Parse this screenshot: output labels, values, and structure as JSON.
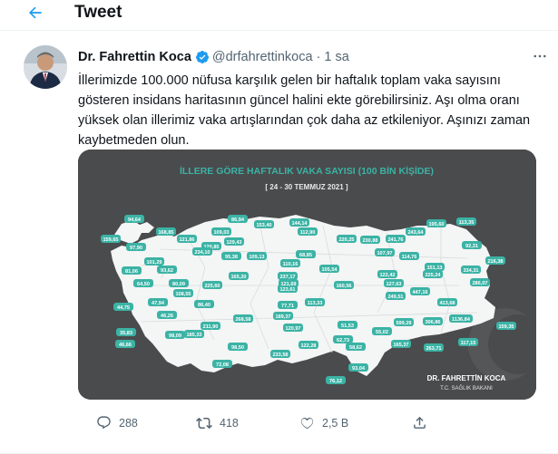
{
  "header": {
    "title": "Tweet"
  },
  "tweet": {
    "author_name": "Dr. Fahrettin Koca",
    "handle": "@drfahrettinkoca",
    "separator": "·",
    "time": "1 sa",
    "text_lines": [
      "İllerimizde 100.000 nüfusa karşılık gelen bir haftalık toplam vaka sayısını",
      "gösteren insidans haritasının güncel halini ekte görebilirsiniz. Aşı olma oranı",
      "yüksek olan illerimiz vaka artışlarından çok daha az etkileniyor. Aşınızı zaman",
      "kaybetmeden olun."
    ]
  },
  "media": {
    "title": "İLLERE GÖRE HAFTALIK VAKA SAYISI (100 BİN KİŞİDE)",
    "date_range": "[ 24 - 30 TEMMUZ 2021 ]",
    "footer_name": "DR. FAHRETTİN KOCA",
    "footer_sub": "T.C. SAĞLIK BAKANI",
    "colors": {
      "background": "#4a4b4d",
      "map": "#f4f5f5",
      "label": "#3bb3a5",
      "title": "#3bb3a5"
    },
    "province_labels": [
      {
        "text": "94,64"
      },
      {
        "text": "86,94"
      },
      {
        "text": "153,40"
      },
      {
        "text": "144,14"
      },
      {
        "text": "195,60"
      },
      {
        "text": "113,35"
      },
      {
        "text": "159,65"
      },
      {
        "text": "168,85"
      },
      {
        "text": "121,86"
      },
      {
        "text": "109,03"
      },
      {
        "text": "112,90"
      },
      {
        "text": "220,25"
      },
      {
        "text": "230,88"
      },
      {
        "text": "241,76"
      },
      {
        "text": "243,64"
      },
      {
        "text": "97,90"
      },
      {
        "text": "120,85"
      },
      {
        "text": "129,43"
      },
      {
        "text": "92,31"
      },
      {
        "text": "216,38"
      },
      {
        "text": "101,29"
      },
      {
        "text": "234,10"
      },
      {
        "text": "95,38"
      },
      {
        "text": "109,13"
      },
      {
        "text": "68,85"
      },
      {
        "text": "107,97"
      },
      {
        "text": "114,76"
      },
      {
        "text": "81,06"
      },
      {
        "text": "93,62"
      },
      {
        "text": "110,16"
      },
      {
        "text": "151,13"
      },
      {
        "text": "334,31"
      },
      {
        "text": "64,50"
      },
      {
        "text": "80,09"
      },
      {
        "text": "165,20"
      },
      {
        "text": "237,17"
      },
      {
        "text": "105,54"
      },
      {
        "text": "122,42"
      },
      {
        "text": "225,24"
      },
      {
        "text": "123,61"
      },
      {
        "text": "108,55"
      },
      {
        "text": "225,60"
      },
      {
        "text": "121,69"
      },
      {
        "text": "160,56"
      },
      {
        "text": "127,63"
      },
      {
        "text": "447,16"
      },
      {
        "text": "286,07"
      },
      {
        "text": "44,75"
      },
      {
        "text": "47,94"
      },
      {
        "text": "86,40"
      },
      {
        "text": "113,33"
      },
      {
        "text": "77,71"
      },
      {
        "text": "249,51"
      },
      {
        "text": "413,68"
      },
      {
        "text": "46,26"
      },
      {
        "text": "211,90"
      },
      {
        "text": "268,58"
      },
      {
        "text": "189,37"
      },
      {
        "text": "51,53"
      },
      {
        "text": "599,29"
      },
      {
        "text": "306,86"
      },
      {
        "text": "1136,84"
      },
      {
        "text": "159,35"
      },
      {
        "text": "35,83"
      },
      {
        "text": "98,09"
      },
      {
        "text": "185,33"
      },
      {
        "text": "120,97"
      },
      {
        "text": "62,73"
      },
      {
        "text": "55,02"
      },
      {
        "text": "117,15"
      },
      {
        "text": "46,66"
      },
      {
        "text": "98,50"
      },
      {
        "text": "122,28"
      },
      {
        "text": "58,62"
      },
      {
        "text": "165,37"
      },
      {
        "text": "263,71"
      },
      {
        "text": "72,08"
      },
      {
        "text": "233,58"
      },
      {
        "text": "93,04"
      },
      {
        "text": "76,12"
      }
    ]
  },
  "actions": {
    "reply_count": "288",
    "retweet_count": "418",
    "like_count": "2,5 B"
  }
}
